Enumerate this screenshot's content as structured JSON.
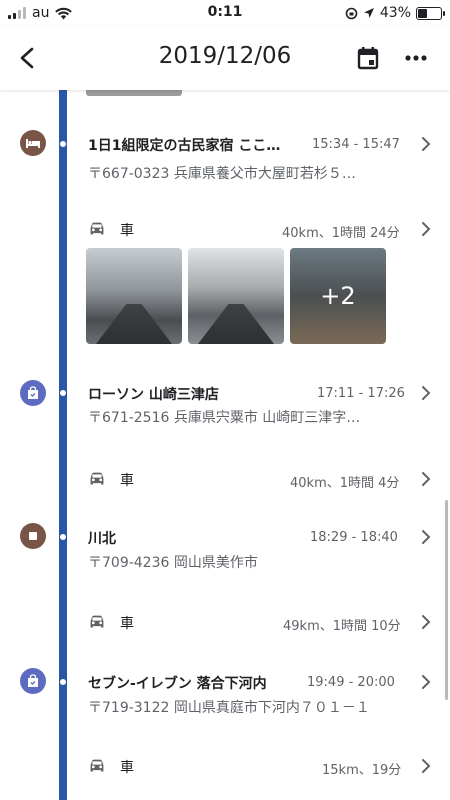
{
  "status_bar": {
    "carrier": "au",
    "time": "0:11",
    "battery_percent": "43%",
    "battery_level": 0.43
  },
  "header": {
    "title": "2019/12/06",
    "back_icon": "chevron-left-icon",
    "calendar_icon": "calendar-icon",
    "more_icon": "more-horiz-icon"
  },
  "timeline": {
    "places": [
      {
        "name": "1日1組限定の古民家宿 ここ…",
        "time": "15:34 - 15:47",
        "address": "〒667-0323 兵庫県養父市大屋町若杉５…",
        "icon": "hotel-icon"
      },
      {
        "name": "ローソン 山崎三津店",
        "time": "17:11 - 17:26",
        "address": "〒671-2516 兵庫県宍粟市 山崎町三津字…",
        "icon": "shopping-bag-icon"
      },
      {
        "name": "川北",
        "time": "18:29 - 18:40",
        "address": "〒709-4236 岡山県美作市",
        "icon": "place-icon"
      },
      {
        "name": "セブン-イレブン 落合下河内",
        "time": "19:49 - 20:00",
        "address": "〒719-3122 岡山県真庭市下河内７０１－１",
        "icon": "shopping-bag-icon"
      }
    ],
    "moves": [
      {
        "mode": "車",
        "meta": "40km、1時間 24分",
        "icon": "car-icon"
      },
      {
        "mode": "車",
        "meta": "40km、1時間 4分",
        "icon": "car-icon"
      },
      {
        "mode": "車",
        "meta": "49km、1時間 10分",
        "icon": "car-icon"
      },
      {
        "mode": "車",
        "meta": "15km、19分",
        "icon": "car-icon"
      }
    ],
    "photos_more": "+2"
  }
}
